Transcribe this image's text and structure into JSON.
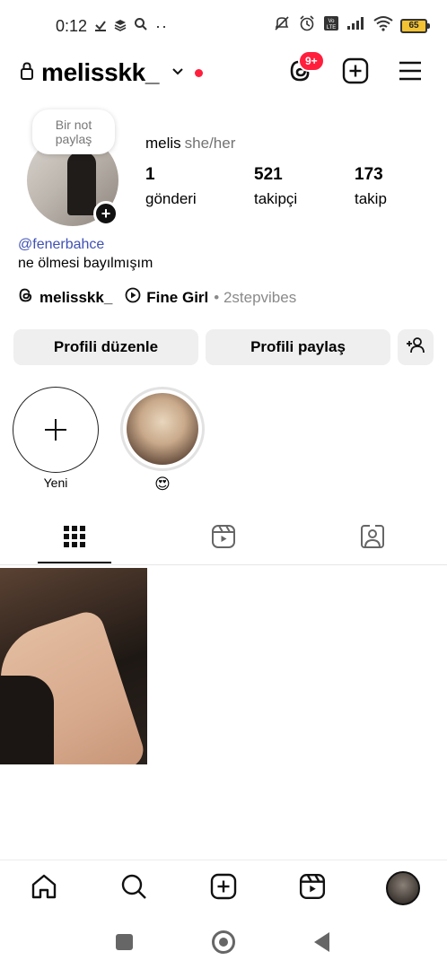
{
  "status_bar": {
    "time": "0:12",
    "battery": "65",
    "icons": [
      "check-icon",
      "stack-icon",
      "search-icon",
      "more-icon",
      "mute-icon",
      "alarm-icon",
      "volte-icon",
      "signal-icon",
      "wifi-icon",
      "battery-icon"
    ]
  },
  "header": {
    "username": "melisskk_",
    "notification_badge": "9+",
    "icons": [
      "lock-icon",
      "chevron-down-icon",
      "threads-icon",
      "add-post-icon",
      "menu-icon"
    ]
  },
  "profile": {
    "note_line1": "Bir not",
    "note_line2": "paylaş",
    "display_name": "melis",
    "pronouns": "she/her",
    "stats": {
      "posts_count": "1",
      "posts_label": "gönderi",
      "followers_count": "521",
      "followers_label": "takipçi",
      "following_count": "173",
      "following_label": "takip"
    },
    "bio_link": "@fenerbahce",
    "bio_text": "ne ölmesi bayılmışım",
    "threads_handle": "melisskk_",
    "song_title": "Fine Girl",
    "song_artist": "• 2stepvibes"
  },
  "actions": {
    "edit_profile": "Profili düzenle",
    "share_profile": "Profili paylaş"
  },
  "highlights": {
    "new_label": "Yeni",
    "story_label": "😍"
  },
  "tabs": [
    "grid-icon",
    "reels-icon",
    "tagged-icon"
  ],
  "bottom_nav": [
    "home-icon",
    "search-icon",
    "create-icon",
    "reels-icon",
    "profile-avatar"
  ]
}
